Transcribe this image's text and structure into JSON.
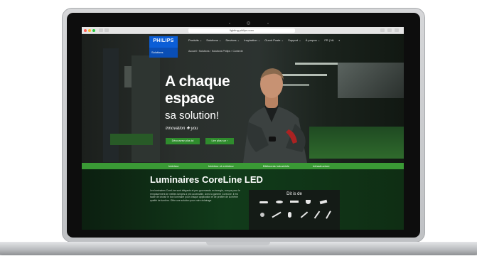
{
  "browser": {
    "url": "lighting.philips.com"
  },
  "site": {
    "logo": {
      "brand": "PHILIPS",
      "sub": "Solutions"
    },
    "menu": [
      "Produits ⌄",
      "Solutions ⌄",
      "Services ⌄",
      "Inspiration ⌄",
      "Ouvrir Poste ⌄",
      "Support ⌄",
      "À propos ⌄",
      "FR | NL",
      "⌕"
    ],
    "breadcrumb": "Accueil › Solutions › Solutions Philips › Contexte",
    "hero": {
      "headline_line1": "A chaque",
      "headline_line2": "espace",
      "subheadline": "sa solution!",
      "tagline": "innovation ✚ you",
      "button_primary": "Découvrez plus ici",
      "button_secondary": "Lire plus sur ›"
    },
    "greenbar_items": [
      "Intérieur",
      "Intérieur et extérieur",
      "Bâtiments industriels",
      "Infrastructure"
    ],
    "section": {
      "title": "Luminaires CoreLine LED",
      "paragraph": "Les luminaires CoreLine sont élégants et peu gourmands en énergie, conçus pour le remplacement de vieilles lampes à prix accessible. Avec la gamme CoreLine, il est facile de choisir le bon luminaire pour chaque application et de profiter de la même qualité de lumière. Offre une solution pour votre éclairage.",
      "dit_title": "Dit is de"
    }
  }
}
